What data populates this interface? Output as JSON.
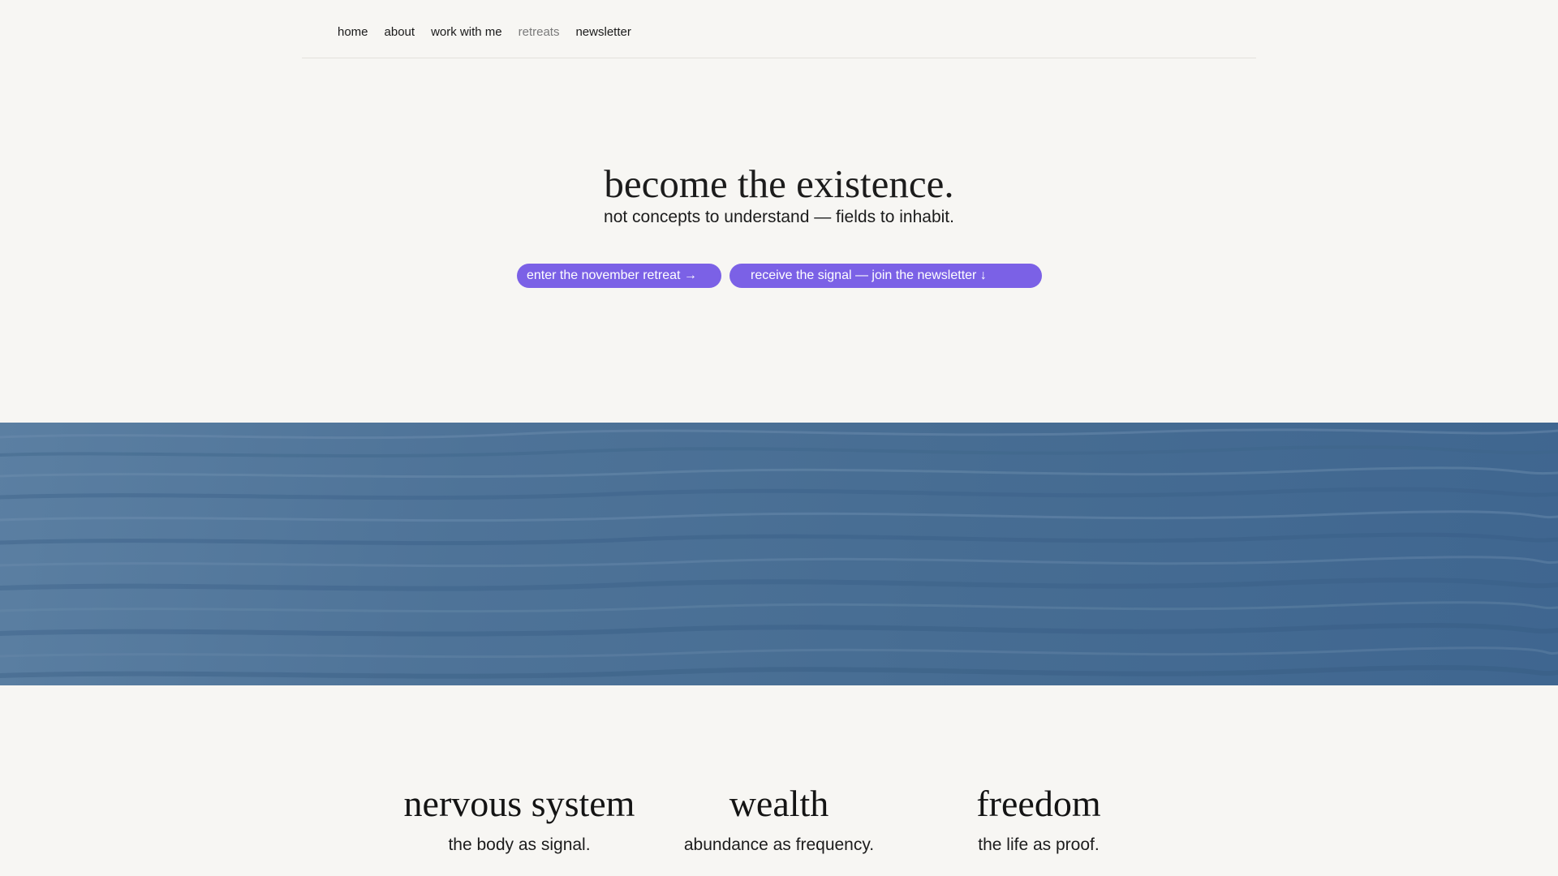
{
  "nav": {
    "items": [
      {
        "label": "home"
      },
      {
        "label": "about"
      },
      {
        "label": "work with me"
      },
      {
        "label": "retreats",
        "active": true
      },
      {
        "label": "newsletter"
      }
    ]
  },
  "hero": {
    "title": "become the existence.",
    "subtitle": "not concepts to understand — fields to inhabit.",
    "cta_primary": "enter the november retreat →",
    "cta_secondary": "receive the signal — join the newsletter ↓",
    "cta_color": "#7b61e6"
  },
  "banner": {
    "image": "ocean-surface"
  },
  "pillars": [
    {
      "title": "nervous system",
      "subtitle": "the body as signal."
    },
    {
      "title": "wealth",
      "subtitle": "abundance as frequency."
    },
    {
      "title": "freedom",
      "subtitle": "the life as proof."
    }
  ],
  "colors": {
    "background": "#f7f6f3",
    "accent": "#7b61e6",
    "ocean": "#4a7096"
  }
}
